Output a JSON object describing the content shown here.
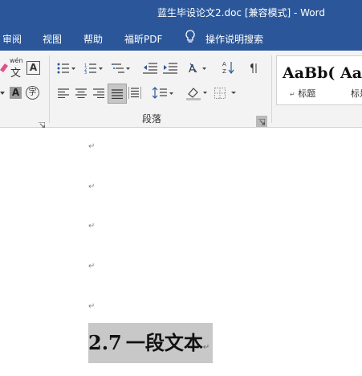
{
  "window": {
    "title": "蓝生毕设论文2.doc [兼容模式]  -  Word"
  },
  "tabs": [
    {
      "label": "审阅"
    },
    {
      "label": "视图"
    },
    {
      "label": "帮助"
    },
    {
      "label": "福昕PDF"
    }
  ],
  "search": {
    "label": "操作说明搜索"
  },
  "ribbon": {
    "font_group": {
      "phonetic_top": "wén",
      "phonetic_char": "文",
      "border_char": "A",
      "shade_char": "A",
      "enclose_char": "字"
    },
    "paragraph_group": {
      "label": "段落"
    },
    "styles": [
      {
        "sample": "AaBb(",
        "name": "标题"
      },
      {
        "sample": "AaI",
        "name": "标是"
      }
    ]
  },
  "document": {
    "paragraph_mark": "↵",
    "heading": {
      "number": "2.7",
      "text": "一段文本"
    }
  }
}
